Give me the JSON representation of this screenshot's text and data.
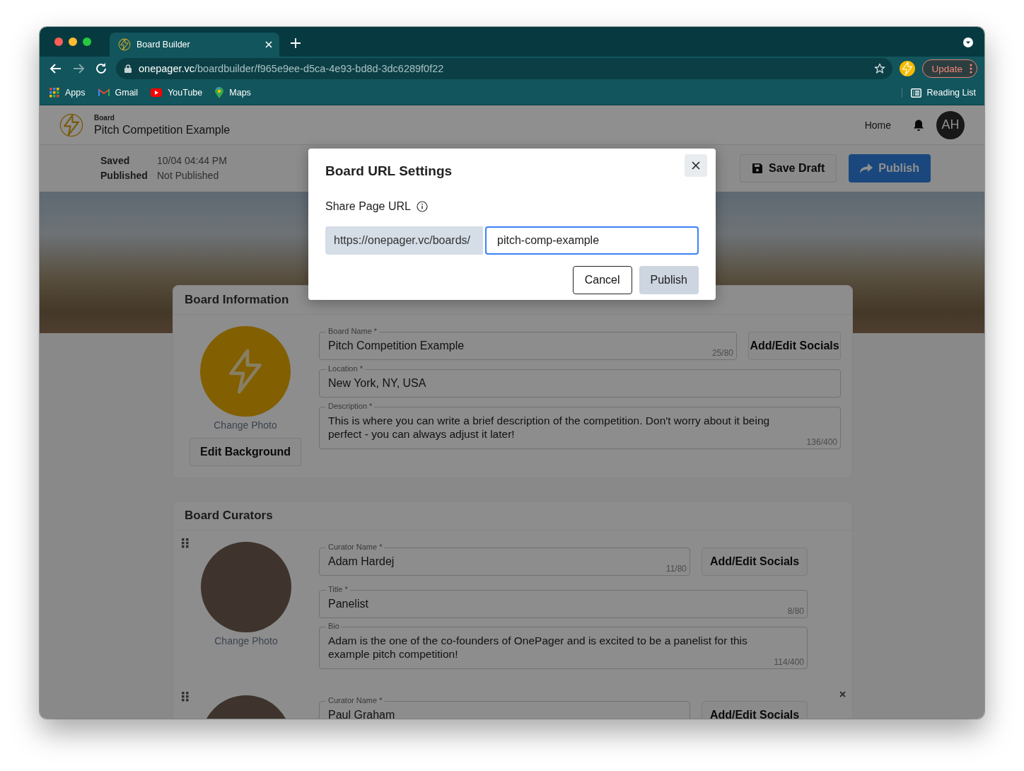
{
  "browser": {
    "tab_title": "Board Builder",
    "url_host": "onepager.vc",
    "url_path": "/boardbuilder/f965e9ee-d5ca-4e93-bd8d-3dc6289f0f22",
    "update_button": "Update",
    "reading_list": "Reading List",
    "bookmarks": [
      {
        "label": "Apps",
        "kind": "apps"
      },
      {
        "label": "Gmail",
        "kind": "mail"
      },
      {
        "label": "YouTube",
        "kind": "video"
      },
      {
        "label": "Maps",
        "kind": "map"
      }
    ]
  },
  "header": {
    "overline": "Board",
    "title": "Pitch Competition Example",
    "nav_link": "Home",
    "avatar_initials": "AH"
  },
  "status": [
    {
      "label": "Saved",
      "value": "10/04 04:44 PM"
    },
    {
      "label": "Published",
      "value": "Not Published"
    }
  ],
  "actions": {
    "save_draft": "Save Draft",
    "publish": "Publish"
  },
  "board_information": {
    "title": "Board Information",
    "change_photo": "Change Photo",
    "edit_background": "Edit Background",
    "socials_button": "Add/Edit Socials",
    "fields": [
      {
        "label": "Board Name *",
        "value": "Pitch Competition Example",
        "counter": "25/80",
        "kind": "text"
      },
      {
        "label": "Location *",
        "value": "New York, NY, USA",
        "kind": "text"
      },
      {
        "label": "Description *",
        "value": "This is where you can write a brief description of the competition. Don't worry about it being perfect - you can always adjust it later!",
        "counter": "136/400",
        "kind": "textarea"
      }
    ]
  },
  "board_curators": {
    "title": "Board Curators",
    "curators": [
      {
        "change_photo": "Change Photo",
        "socials_button": "Add/Edit Socials",
        "removable": false,
        "fields": [
          {
            "label": "Curator Name *",
            "value": "Adam Hardej",
            "counter": "11/80",
            "kind": "text"
          },
          {
            "label": "Title *",
            "value": "Panelist",
            "counter": "8/80",
            "kind": "text"
          },
          {
            "label": "Bio",
            "value": "Adam is the one of the co-founders of OnePager and is excited to be a panelist for this example pitch competition!",
            "counter": "114/400",
            "kind": "textarea"
          }
        ]
      },
      {
        "socials_button": "Add/Edit Socials",
        "removable": true,
        "fields": [
          {
            "label": "Curator Name *",
            "value": "Paul Graham",
            "kind": "text"
          }
        ]
      }
    ]
  },
  "dialog": {
    "title": "Board URL Settings",
    "field_label": "Share Page URL",
    "url_prefix": "https://onepager.vc/boards/",
    "url_value": "pitch-comp-example",
    "cancel_button": "Cancel",
    "publish_button": "Publish"
  }
}
